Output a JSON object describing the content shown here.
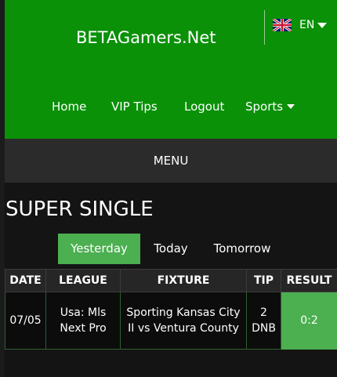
{
  "header": {
    "brand": "BETAGamers.Net",
    "language": {
      "code": "EN",
      "flag": "uk-flag-icon"
    },
    "nav": [
      {
        "label": "Home"
      },
      {
        "label": "VIP Tips"
      },
      {
        "label": "Logout"
      },
      {
        "label": "Sports"
      }
    ]
  },
  "menu_bar": {
    "label": "MENU"
  },
  "page_title": "SUPER SINGLE",
  "tabs": [
    {
      "label": "Yesterday",
      "active": true
    },
    {
      "label": "Today",
      "active": false
    },
    {
      "label": "Tomorrow",
      "active": false
    }
  ],
  "table": {
    "columns": [
      "DATE",
      "LEAGUE",
      "FIXTURE",
      "TIP",
      "RESULT"
    ],
    "rows": [
      {
        "date": "07/05",
        "league": "Usa: Mls Next Pro",
        "fixture": "Sporting Kansas City II vs Ventura County",
        "tip": "2 DNB",
        "result": "0:2"
      }
    ]
  },
  "colors": {
    "header_green": "#0a9108",
    "accent_green": "#4caf50",
    "background": "#141414",
    "menu_bar": "#2b2b2b"
  }
}
